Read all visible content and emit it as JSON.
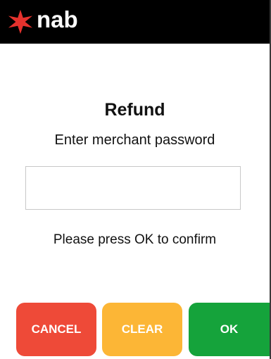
{
  "header": {
    "logo_text": "nab",
    "logo_icon": "nab-star-icon",
    "background": "#000000",
    "star_color": "#e5322d"
  },
  "main": {
    "title": "Refund",
    "subtitle": "Enter merchant password",
    "password_value": "",
    "password_placeholder": "",
    "confirm_text": "Please press OK to confirm"
  },
  "buttons": {
    "cancel_label": "CANCEL",
    "clear_label": "CLEAR",
    "ok_label": "OK",
    "cancel_color": "#ee4a38",
    "clear_color": "#fcb636",
    "ok_color": "#15a33b"
  }
}
